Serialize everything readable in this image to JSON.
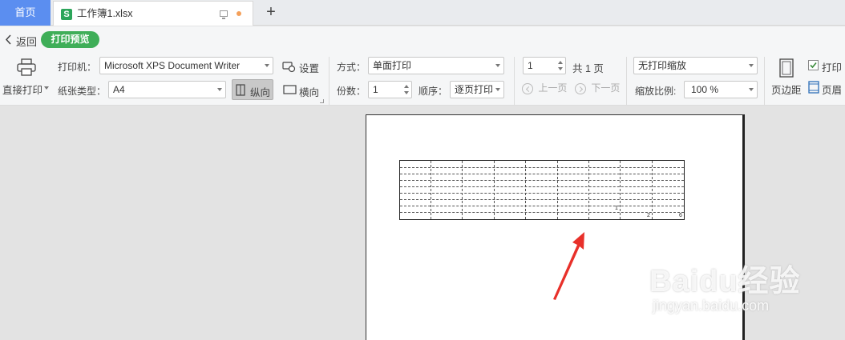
{
  "tabs": {
    "home": "首页",
    "file": "工作簿1.xlsx",
    "file_icon_letter": "S",
    "add": "+"
  },
  "nav": {
    "back": "返回",
    "print_preview": "打印预览"
  },
  "toolbar": {
    "direct_print": "直接打印",
    "printer_label": "打印机：",
    "printer_value": "Microsoft XPS Document Writer",
    "settings": "设置",
    "paper_label": "纸张类型：",
    "paper_value": "A4",
    "portrait": "纵向",
    "landscape": "横向",
    "mode_label": "方式：",
    "mode_value": "单面打印",
    "copies_label": "份数：",
    "copies_value": "1",
    "order_label": "顺序：",
    "order_value": "逐页打印",
    "page_value": "1",
    "page_total": "共 1 页",
    "prev_page": "上一页",
    "next_page": "下一页",
    "scale_value": "无打印缩放",
    "zoom_label": "缩放比例:",
    "zoom_value": "100 %",
    "margins": "页边距",
    "print_check_label": "打印",
    "header_footer_label": "页眉"
  },
  "preview": {
    "cell_numbers": [
      "1",
      "2",
      "6"
    ]
  },
  "watermark": {
    "text": "Baidu经验",
    "url": "jingyan.baidu.com"
  },
  "colors": {
    "home_tab": "#5b8ef0",
    "preview_pill": "#3fae58",
    "arrow": "#e8302a"
  }
}
